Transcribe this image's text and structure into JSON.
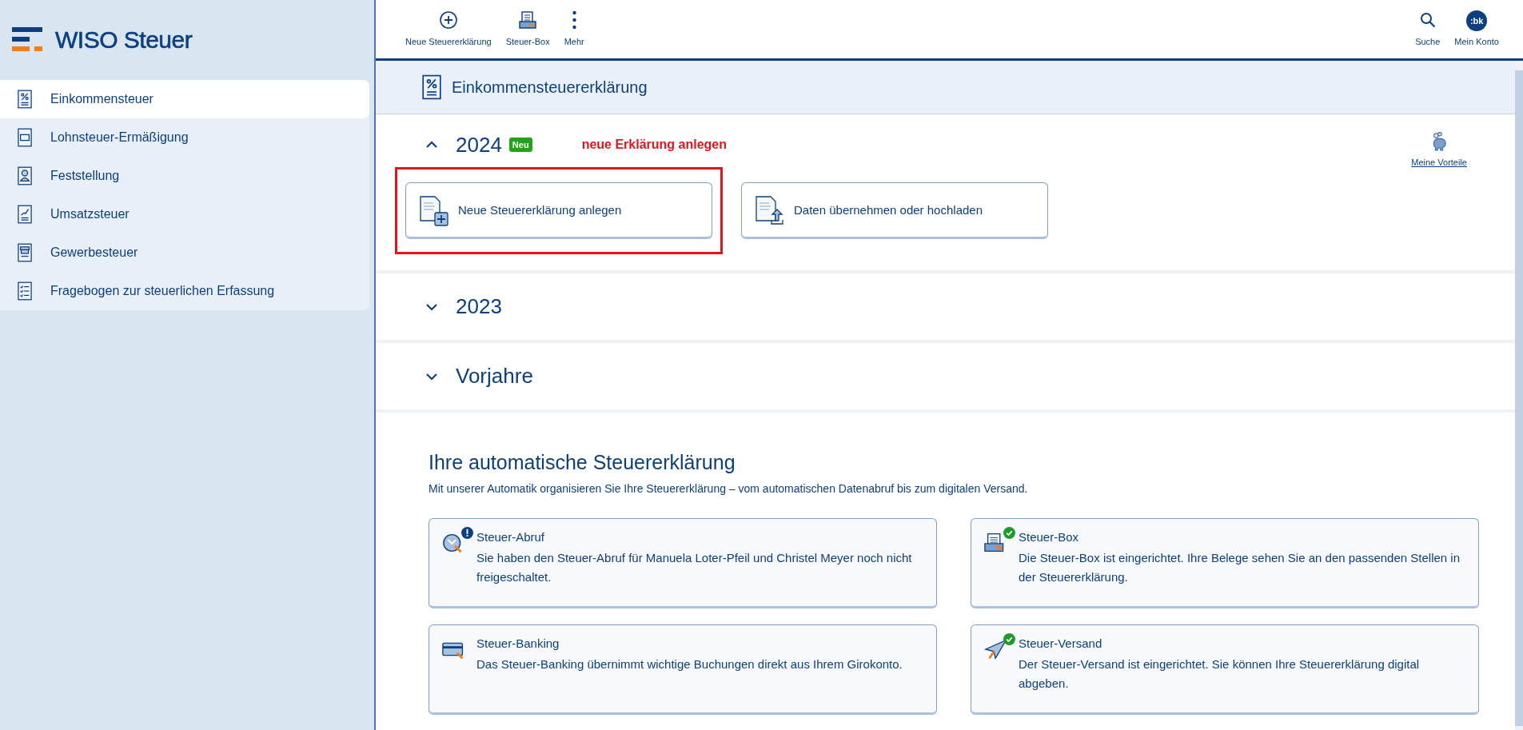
{
  "logo": {
    "text": "WISO Steuer"
  },
  "sidebar": {
    "items": [
      {
        "label": "Einkommensteuer",
        "kind": "percent",
        "selected": true
      },
      {
        "label": "Lohnsteuer-Ermäßigung",
        "kind": "card",
        "selected": false
      },
      {
        "label": "Feststellung",
        "kind": "people",
        "selected": false
      },
      {
        "label": "Umsatzsteuer",
        "kind": "chart",
        "selected": false
      },
      {
        "label": "Gewerbesteuer",
        "kind": "shop",
        "selected": false
      },
      {
        "label": "Fragebogen zur steuerlichen Erfassung",
        "kind": "checklist",
        "selected": false
      }
    ]
  },
  "toolbar": {
    "left": [
      {
        "label": "Neue Steuererklärung",
        "kind": "plus"
      },
      {
        "label": "Steuer-Box",
        "kind": "box"
      },
      {
        "label": "Mehr",
        "kind": "dots"
      }
    ],
    "right": [
      {
        "label": "Suche",
        "kind": "search"
      },
      {
        "label": "Mein Konto",
        "kind": "avatar",
        "avatar_text": ":bk"
      }
    ]
  },
  "page_header": {
    "title": "Einkommensteuererklärung"
  },
  "benefits_link": "Meine Vorteile",
  "years": [
    {
      "year": "2024",
      "expanded": true,
      "badge": "Neu",
      "annotation": "neue Erklärung anlegen",
      "actions": [
        {
          "label": "Neue Steuererklärung anlegen",
          "kind": "add",
          "highlighted": true
        },
        {
          "label": "Daten übernehmen oder hochladen",
          "kind": "upload",
          "highlighted": false
        }
      ]
    },
    {
      "year": "2023",
      "expanded": false
    },
    {
      "year": "Vorjahre",
      "expanded": false
    }
  ],
  "automation": {
    "title": "Ihre automatische Steuererklärung",
    "subtitle": "Mit unserer Automatik organisieren Sie Ihre Steuererklärung – vom automatischen Datenabruf bis zum digitalen Versand.",
    "cards": [
      {
        "title": "Steuer-Abruf",
        "text": "Sie haben den Steuer-Abruf für Manuela Loter-Pfeil und Christel Meyer noch nicht freigeschaltet.",
        "kind": "download",
        "checked": false,
        "alert": true
      },
      {
        "title": "Steuer-Box",
        "text": "Die Steuer-Box ist eingerichtet. Ihre Belege sehen Sie an den passenden Stellen in der Steuererklärung.",
        "kind": "box",
        "checked": true,
        "alert": false
      },
      {
        "title": "Steuer-Banking",
        "text": "Das Steuer-Banking übernimmt wichtige Buchungen direkt aus Ihrem Girokonto.",
        "kind": "card",
        "checked": false,
        "alert": false
      },
      {
        "title": "Steuer-Versand",
        "text": "Der Steuer-Versand ist eingerichtet. Sie können Ihre Steuererklärung digital abgeben.",
        "kind": "plane",
        "checked": true,
        "alert": false
      }
    ]
  }
}
